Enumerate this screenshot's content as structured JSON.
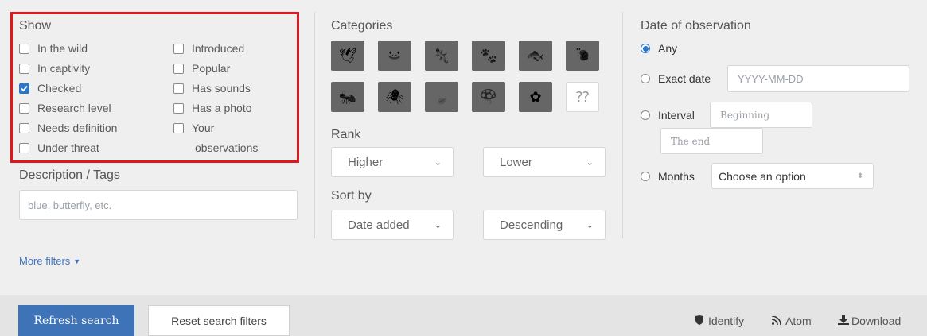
{
  "show": {
    "title": "Show",
    "col1": [
      {
        "label": "In the wild",
        "checked": false
      },
      {
        "label": "In captivity",
        "checked": false
      },
      {
        "label": "Checked",
        "checked": true
      },
      {
        "label": "Research level",
        "checked": false
      },
      {
        "label": "Needs definition",
        "checked": false
      },
      {
        "label": "Under threat",
        "checked": false
      }
    ],
    "col2": [
      {
        "label": "Introduced",
        "checked": false
      },
      {
        "label": "Popular",
        "checked": false
      },
      {
        "label": "Has sounds",
        "checked": false
      },
      {
        "label": "Has a photo",
        "checked": false
      },
      {
        "label": "Your",
        "checked": false
      }
    ],
    "col2_wrap": "observations"
  },
  "description": {
    "title": "Description / Tags",
    "placeholder": "blue, butterfly, etc."
  },
  "more_filters": "More filters",
  "categories": {
    "title": "Categories",
    "icons": [
      "bird-icon",
      "amphibian-icon",
      "reptile-icon",
      "mammal-icon",
      "fish-icon",
      "mollusk-icon",
      "insect-icon",
      "arachnid-icon",
      "plant-icon",
      "fungi-icon",
      "protozoa-icon",
      "unknown-icon"
    ]
  },
  "rank": {
    "title": "Rank",
    "higher": "Higher",
    "lower": "Lower"
  },
  "sort": {
    "title": "Sort by",
    "field": "Date added",
    "order": "Descending"
  },
  "date": {
    "title": "Date of observation",
    "any": "Any",
    "exact": "Exact date",
    "exact_placeholder": "YYYY-MM-DD",
    "interval": "Interval",
    "beginning": "Beginning",
    "end": "The end",
    "months": "Months",
    "months_value": "Choose an option"
  },
  "footer": {
    "refresh": "Refresh search",
    "reset": "Reset search filters",
    "identify": "Identify",
    "atom": "Atom",
    "download": "Download"
  },
  "colors": {
    "accent": "#3f73b8",
    "highlight": "#e0181c"
  }
}
